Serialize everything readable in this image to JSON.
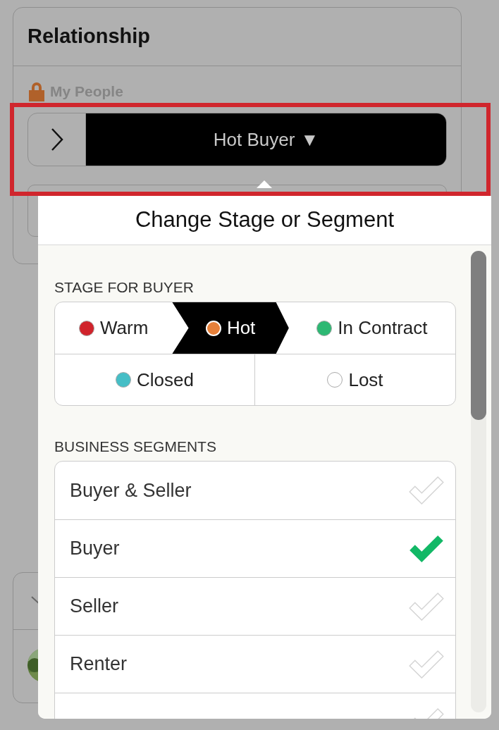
{
  "card": {
    "title": "Relationship",
    "privacy_label": "My People",
    "stage_button": {
      "label": "Hot Buyer",
      "caret": "▼"
    }
  },
  "popover": {
    "title": "Change Stage or Segment",
    "stage_section": {
      "heading": "STAGE FOR BUYER",
      "rows": [
        {
          "items": [
            {
              "label": "Warm",
              "color": "#d0232b",
              "selected": false
            },
            {
              "label": "Hot",
              "color": "#e6803a",
              "selected": true
            },
            {
              "label": "In Contract",
              "color": "#2db873",
              "selected": false
            }
          ]
        },
        {
          "items": [
            {
              "label": "Closed",
              "color": "#45bec6",
              "selected": false
            },
            {
              "label": "Lost",
              "color": "#ffffff",
              "selected": false
            }
          ]
        }
      ]
    },
    "segment_section": {
      "heading": "BUSINESS SEGMENTS",
      "items": [
        {
          "label": "Buyer & Seller",
          "checked": false
        },
        {
          "label": "Buyer",
          "checked": true
        },
        {
          "label": "Seller",
          "checked": false
        },
        {
          "label": "Renter",
          "checked": false
        },
        {
          "checked": false
        }
      ]
    }
  }
}
